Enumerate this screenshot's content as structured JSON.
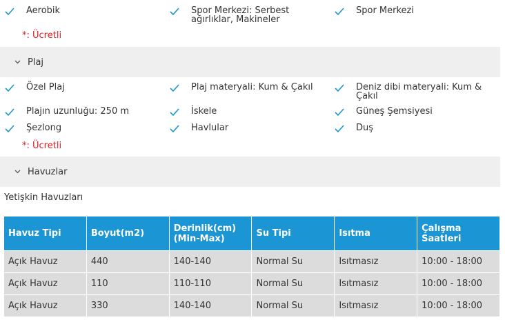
{
  "top_features": [
    {
      "label": "Aerobik"
    },
    {
      "label": "Spor Merkezi: Serbest ağırlıklar, Makineler"
    },
    {
      "label": "Spor Merkezi"
    }
  ],
  "paid_note": "*: Ücretli",
  "beach_section": {
    "title": "Plaj"
  },
  "beach_features": [
    {
      "label": "Özel Plaj"
    },
    {
      "label": "Plaj materyali: Kum & Çakıl"
    },
    {
      "label": "Deniz dibi materyali: Kum & Çakıl"
    },
    {
      "label": "Plajın uzunluğu: 250 m"
    },
    {
      "label": "İskele"
    },
    {
      "label": "Güneş Şemsiyesi"
    },
    {
      "label": "Şezlong"
    },
    {
      "label": "Havlular"
    },
    {
      "label": "Duş"
    }
  ],
  "pools_section": {
    "title": "Havuzlar"
  },
  "pools_subtitle": "Yetişkin Havuzları",
  "pool_table": {
    "headers": [
      "Havuz Tipi",
      "Boyut(m2)",
      "Derinlik(cm) (Min-Max)",
      "Su Tipi",
      "Isıtma",
      "Çalışma Saatleri"
    ],
    "rows": [
      [
        "Açık Havuz",
        "440",
        "140-140",
        "Normal Su",
        "Isıtmasız",
        "10:00 - 18:00"
      ],
      [
        "Açık Havuz",
        "110",
        "110-110",
        "Normal Su",
        "Isıtmasız",
        "10:00 - 18:00"
      ],
      [
        "Açık Havuz",
        "330",
        "140-140",
        "Normal Su",
        "Isıtmasız",
        "10:00 - 18:00"
      ]
    ]
  },
  "colors": {
    "accent": "#1b95d4",
    "check": "#1b95d4",
    "paid": "#e31b23",
    "section_bg": "#efefef",
    "cell_bg": "#dcdcdc"
  },
  "icons": {
    "check": "check-icon",
    "chevron": "chevron-down-icon"
  }
}
